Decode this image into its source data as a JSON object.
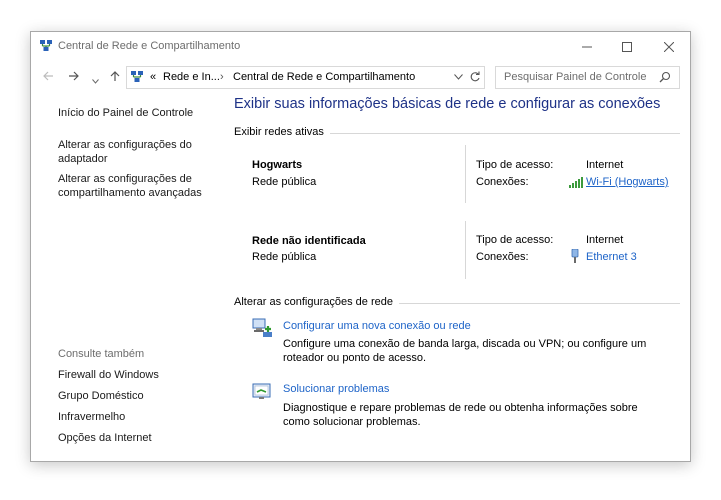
{
  "window": {
    "title": "Central de Rede e Compartilhamento"
  },
  "address": {
    "crumb_overflow": "«",
    "crumb_1": "Rede e In...",
    "sep": "›",
    "crumb_2": "Central de Rede e Compartilhamento",
    "search_placeholder": "Pesquisar Painel de Controle"
  },
  "sidebar": {
    "home": "Início do Painel de Controle",
    "items": [
      "Alterar as configurações do adaptador",
      "Alterar as configurações de compartilhamento avançadas"
    ],
    "see_also_title": "Consulte também",
    "see_also": [
      "Firewall do Windows",
      "Grupo Doméstico",
      "Infravermelho",
      "Opções da Internet"
    ]
  },
  "main": {
    "title": "Exibir suas informações básicas de rede e configurar as conexões",
    "active_label": "Exibir redes ativas",
    "networks": [
      {
        "name": "Hogwarts",
        "type": "Rede pública",
        "access_label": "Tipo de acesso:",
        "access_value": "Internet",
        "conn_label": "Conexões:",
        "conn_value": "Wi-Fi (Hogwarts)",
        "conn_icon": "wifi-signal-icon"
      },
      {
        "name": "Rede não identificada",
        "type": "Rede pública",
        "access_label": "Tipo de acesso:",
        "access_value": "Internet",
        "conn_label": "Conexões:",
        "conn_value": "Ethernet 3",
        "conn_icon": "ethernet-icon"
      }
    ],
    "change_label": "Alterar as configurações de rede",
    "tasks": [
      {
        "icon": "new-connection-icon",
        "title": "Configurar uma nova conexão ou rede",
        "desc": "Configure uma conexão de banda larga, discada ou VPN; ou configure um roteador ou ponto de acesso."
      },
      {
        "icon": "troubleshoot-icon",
        "title": "Solucionar problemas",
        "desc": "Diagnostique e repare problemas de rede ou obtenha informações sobre como solucionar problemas."
      }
    ]
  },
  "colors": {
    "link": "#1e64c8",
    "heading": "#1e3287"
  }
}
